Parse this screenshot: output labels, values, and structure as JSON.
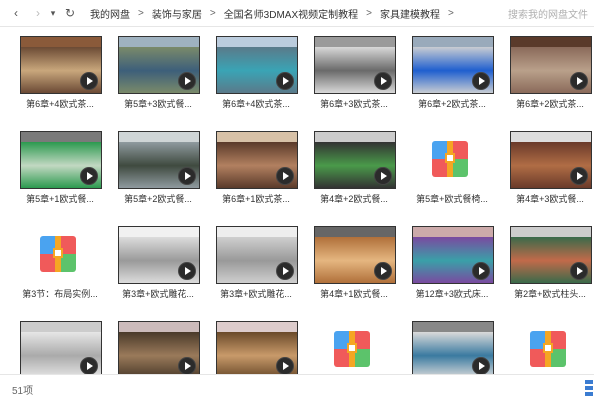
{
  "toolbar": {
    "back_icon": "chevron-left-icon",
    "forward_icon": "chevron-right-icon",
    "dropdown_icon": "chevron-down-icon",
    "refresh_icon": "refresh-icon",
    "back": "‹",
    "forward": "›",
    "dropdown": "▾",
    "refresh": "↻"
  },
  "breadcrumb": {
    "items": [
      "我的网盘",
      "装饰与家居",
      "全国名师3DMAX视频定制教程",
      "家具建模教程"
    ],
    "separator": ">"
  },
  "search": {
    "placeholder": "搜索我的网盘文件",
    "icon": "search-icon"
  },
  "files": [
    {
      "name": "第6章+4欧式茶...",
      "type": "video"
    },
    {
      "name": "第5章+3欧式餐...",
      "type": "video"
    },
    {
      "name": "第6章+4欧式茶...",
      "type": "video"
    },
    {
      "name": "第6章+3欧式茶...",
      "type": "video"
    },
    {
      "name": "第6章+2欧式茶...",
      "type": "video"
    },
    {
      "name": "第6章+2欧式茶...",
      "type": "video"
    },
    {
      "name": "第5章+1欧式餐...",
      "type": "video"
    },
    {
      "name": "第5章+2欧式餐...",
      "type": "video"
    },
    {
      "name": "第6章+1欧式茶...",
      "type": "video"
    },
    {
      "name": "第4章+2欧式餐...",
      "type": "video"
    },
    {
      "name": "第5章+欧式餐椅...",
      "type": "archive"
    },
    {
      "name": "第4章+3欧式餐...",
      "type": "video"
    },
    {
      "name": "第3节：布局实例...",
      "type": "archive"
    },
    {
      "name": "第3章+欧式雕花...",
      "type": "video"
    },
    {
      "name": "第3章+欧式雕花...",
      "type": "video"
    },
    {
      "name": "第4章+1欧式餐...",
      "type": "video"
    },
    {
      "name": "第12章+3欧式床...",
      "type": "video"
    },
    {
      "name": "第2章+欧式柱头...",
      "type": "video"
    },
    {
      "name": "",
      "type": "video"
    },
    {
      "name": "",
      "type": "video"
    },
    {
      "name": "",
      "type": "video"
    },
    {
      "name": "",
      "type": "archive"
    },
    {
      "name": "",
      "type": "video"
    },
    {
      "name": "",
      "type": "archive"
    }
  ],
  "status": {
    "count": "51项"
  },
  "colors": {
    "accent": "#3b7cd1",
    "zip_blue": "#4aa3f0",
    "zip_red": "#f05a5a",
    "zip_green": "#5cc36b",
    "zip_yellow": "#f5a623"
  }
}
